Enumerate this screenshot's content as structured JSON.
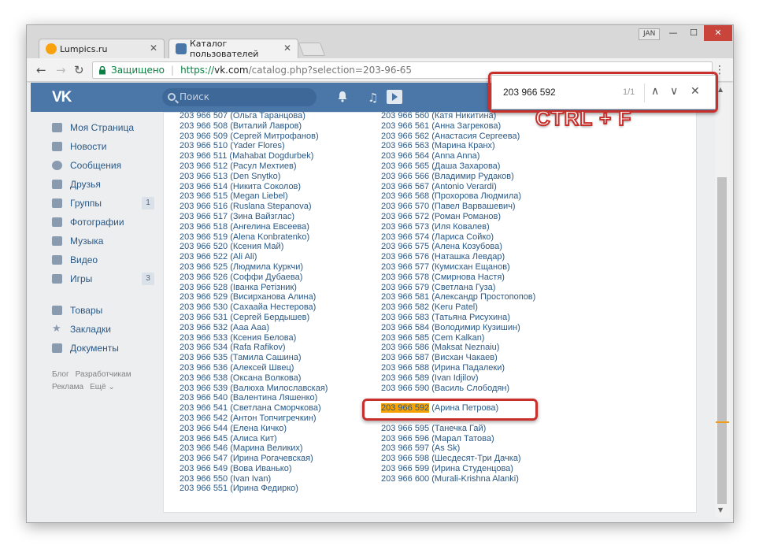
{
  "browser": {
    "tabs": [
      {
        "title": "Lumpics.ru",
        "favicon_color": "#f7a20e"
      },
      {
        "title": "Каталог пользователей",
        "favicon_color": "#4a76a8"
      }
    ],
    "user_badge": "JAN",
    "controls": {
      "minimize": "—",
      "maximize": "☐",
      "close": "✕"
    },
    "nav": {
      "back": "←",
      "forward": "→",
      "reload": "↻"
    },
    "secure_label": "Защищено",
    "url_proto": "https://",
    "url_host": "vk.com",
    "url_rest": "/catalog.php?selection=203-96-65",
    "menu": "⋮"
  },
  "vk_header": {
    "logo": "VK",
    "search_placeholder": "Поиск",
    "bell": "🔔",
    "music": "♫",
    "play": "▶"
  },
  "sidebar": {
    "items": [
      {
        "label": "Моя Страница",
        "count": ""
      },
      {
        "label": "Новости",
        "count": ""
      },
      {
        "label": "Сообщения",
        "count": ""
      },
      {
        "label": "Друзья",
        "count": ""
      },
      {
        "label": "Группы",
        "count": "1"
      },
      {
        "label": "Фотографии",
        "count": ""
      },
      {
        "label": "Музыка",
        "count": ""
      },
      {
        "label": "Видео",
        "count": ""
      },
      {
        "label": "Игры",
        "count": "3"
      }
    ],
    "items2": [
      {
        "label": "Товары"
      },
      {
        "label": "Закладки"
      },
      {
        "label": "Документы"
      }
    ],
    "footer": {
      "blog": "Блог",
      "dev": "Разработчикам",
      "ads": "Реклама",
      "more": "Ещё ⌄"
    }
  },
  "find": {
    "query": "203 966 592",
    "count": "1/1",
    "up": "∧",
    "down": "∨",
    "close": "✕",
    "shortcut_label": "CTRL + F"
  },
  "catalog": {
    "left": [
      "203 966 507 (Ольга Таранцова)",
      "203 966 508 (Виталий Лавров)",
      "203 966 509 (Сергей Митрофанов)",
      "203 966 510 (Yader Flores)",
      "203 966 511 (Mahabat Dogdurbek)",
      "203 966 512 (Расул Мехтиев)",
      "203 966 513 (Den Snytko)",
      "203 966 514 (Никита Соколов)",
      "203 966 515 (Megan Liebel)",
      "203 966 516 (Ruslana Stepanova)",
      "203 966 517 (Зина Вайзглас)",
      "203 966 518 (Ангелина Евсеева)",
      "203 966 519 (Alena Konbratenko)",
      "203 966 520 (Ксения Май)",
      "203 966 522 (Ali Ali)",
      "203 966 525 (Людмила Куркчи)",
      "203 966 526 (Соффи Дубаева)",
      "203 966 528 (Іванка Ретізник)",
      "203 966 529 (Висирханова Алина)",
      "203 966 530 (Сахаайа Нестерова)",
      "203 966 531 (Сергей Бердышев)",
      "203 966 532 (Ааа Ааа)",
      "203 966 533 (Ксения Белова)",
      "203 966 534 (Rafa Rafikov)",
      "203 966 535 (Тамила Сашина)",
      "203 966 536 (Алексей Швец)",
      "203 966 538 (Оксана Волкова)",
      "203 966 539 (Валюха Милославская)",
      "203 966 540 (Валентина Ляшенко)",
      "203 966 541 (Светлана Сморчкова)",
      "203 966 542 (Антон Топчигречкин)",
      "203 966 544 (Елена Кичко)",
      "203 966 545 (Алиса Кит)",
      "203 966 546 (Марина Великих)",
      "203 966 547 (Ирина Рогачевская)",
      "203 966 549 (Вова Иванько)",
      "203 966 550 (Ivan Ivan)",
      "203 966 551 (Ирина Федирко)"
    ],
    "right": [
      "203 966 560 (Катя Никитина)",
      "203 966 561 (Анна Загрекова)",
      "203 966 562 (Анастасия Сергеева)",
      "203 966 563 (Марина Кранх)",
      "203 966 564 (Anna Anna)",
      "203 966 565 (Даша Захарова)",
      "203 966 566 (Владимир Рудаков)",
      "203 966 567 (Antonio Verardi)",
      "203 966 568 (Прохорова Людмила)",
      "203 966 570 (Павел Варвашевич)",
      "203 966 572 (Роман Романов)",
      "203 966 573 (Иля Ковалев)",
      "203 966 574 (Лариса Сойко)",
      "203 966 575 (Алена Козубова)",
      "203 966 576 (Наташка Левдар)",
      "203 966 577 (Кумисхан Ещанов)",
      "203 966 578 (Смирнова Настя)",
      "203 966 579 (Светлана Гуза)",
      "203 966 581 (Александр Простопопов)",
      "203 966 582 (Keru Patel)",
      "203 966 583 (Татьяна Рисухина)",
      "203 966 584 (Володимир Кузишин)",
      "203 966 585 (Cem Kalkan)",
      "203 966 586 (Maksat Neznaiu)",
      "203 966 587 (Висхан Чакаев)",
      "203 966 588 (Ирина Падалеки)",
      "203 966 589 (Ivan Idjilov)",
      "203 966 590 (Василь Слободян)",
      "",
      "",
      "",
      "203 966 595 (Танечка Гай)",
      "203 966 596 (Марал Татова)",
      "203 966 597 (As Sk)",
      "203 966 598 (Шесдесят-Три Дачка)",
      "203 966 599 (Ирина Студенцова)",
      "203 966 600 (Murali-Krishna Alanki)"
    ],
    "highlight_number": "203 966 592",
    "highlight_name": " (Арина Петрова)"
  }
}
